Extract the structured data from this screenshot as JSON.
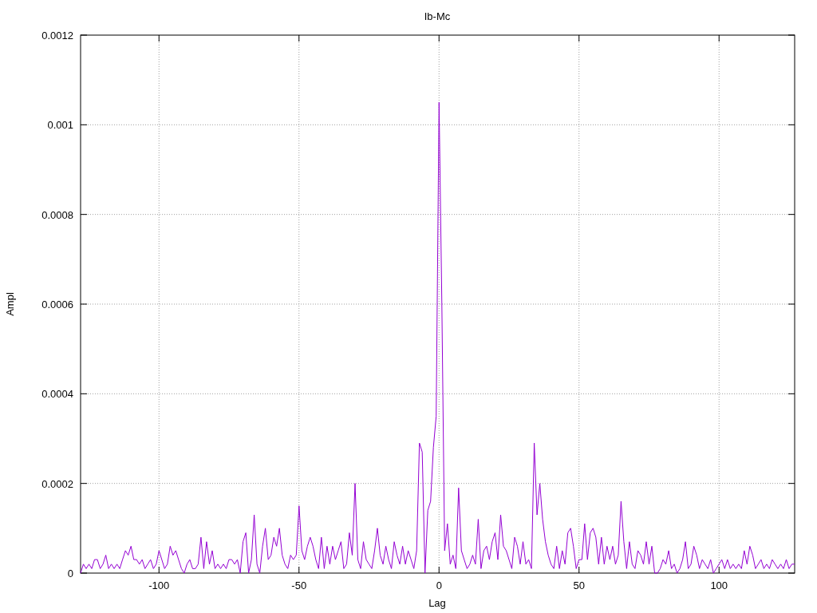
{
  "chart_data": {
    "type": "line",
    "grid": true,
    "title": "Ib-Mc",
    "xlabel": "Lag",
    "ylabel": "Ampl",
    "xlim": [
      -128,
      127
    ],
    "ylim": [
      0,
      0.0012
    ],
    "xticks": [
      -100,
      -50,
      0,
      50,
      100
    ],
    "yticks": [
      {
        "value": 0,
        "label": "0"
      },
      {
        "value": 0.0002,
        "label": "0.0002"
      },
      {
        "value": 0.0004,
        "label": "0.0004"
      },
      {
        "value": 0.0006,
        "label": "0.0006"
      },
      {
        "value": 0.0008,
        "label": "0.0008"
      },
      {
        "value": 0.001,
        "label": "0.001"
      },
      {
        "value": 0.0012,
        "label": "0.0012"
      }
    ],
    "x": [
      -128,
      -127,
      -126,
      -125,
      -124,
      -123,
      -122,
      -121,
      -120,
      -119,
      -118,
      -117,
      -116,
      -115,
      -114,
      -113,
      -112,
      -111,
      -110,
      -109,
      -108,
      -107,
      -106,
      -105,
      -104,
      -103,
      -102,
      -101,
      -100,
      -99,
      -98,
      -97,
      -96,
      -95,
      -94,
      -93,
      -92,
      -91,
      -90,
      -89,
      -88,
      -87,
      -86,
      -85,
      -84,
      -83,
      -82,
      -81,
      -80,
      -79,
      -78,
      -77,
      -76,
      -75,
      -74,
      -73,
      -72,
      -71,
      -70,
      -69,
      -68,
      -67,
      -66,
      -65,
      -64,
      -63,
      -62,
      -61,
      -60,
      -59,
      -58,
      -57,
      -56,
      -55,
      -54,
      -53,
      -52,
      -51,
      -50,
      -49,
      -48,
      -47,
      -46,
      -45,
      -44,
      -43,
      -42,
      -41,
      -40,
      -39,
      -38,
      -37,
      -36,
      -35,
      -34,
      -33,
      -32,
      -31,
      -30,
      -29,
      -28,
      -27,
      -26,
      -25,
      -24,
      -23,
      -22,
      -21,
      -20,
      -19,
      -18,
      -17,
      -16,
      -15,
      -14,
      -13,
      -12,
      -11,
      -10,
      -9,
      -8,
      -7,
      -6,
      -5,
      -4,
      -3,
      -2,
      -1,
      0,
      1,
      2,
      3,
      4,
      5,
      6,
      7,
      8,
      9,
      10,
      11,
      12,
      13,
      14,
      15,
      16,
      17,
      18,
      19,
      20,
      21,
      22,
      23,
      24,
      25,
      26,
      27,
      28,
      29,
      30,
      31,
      32,
      33,
      34,
      35,
      36,
      37,
      38,
      39,
      40,
      41,
      42,
      43,
      44,
      45,
      46,
      47,
      48,
      49,
      50,
      51,
      52,
      53,
      54,
      55,
      56,
      57,
      58,
      59,
      60,
      61,
      62,
      63,
      64,
      65,
      66,
      67,
      68,
      69,
      70,
      71,
      72,
      73,
      74,
      75,
      76,
      77,
      78,
      79,
      80,
      81,
      82,
      83,
      84,
      85,
      86,
      87,
      88,
      89,
      90,
      91,
      92,
      93,
      94,
      95,
      96,
      97,
      98,
      99,
      100,
      101,
      102,
      103,
      104,
      105,
      106,
      107,
      108,
      109,
      110,
      111,
      112,
      113,
      114,
      115,
      116,
      117,
      118,
      119,
      120,
      121,
      122,
      123,
      124,
      125,
      126,
      127
    ],
    "series": [
      {
        "color": "#9400d3",
        "values": [
          0,
          2e-05,
          1e-05,
          2e-05,
          1e-05,
          3e-05,
          3e-05,
          1e-05,
          2e-05,
          4e-05,
          1e-05,
          2e-05,
          1e-05,
          2e-05,
          1e-05,
          3e-05,
          5e-05,
          4e-05,
          6e-05,
          3e-05,
          3e-05,
          2e-05,
          3e-05,
          1e-05,
          2e-05,
          3e-05,
          1e-05,
          2e-05,
          5e-05,
          3e-05,
          1e-05,
          2e-05,
          6e-05,
          4e-05,
          5e-05,
          3e-05,
          1e-05,
          0,
          2e-05,
          3e-05,
          1e-05,
          1e-05,
          2e-05,
          8e-05,
          1e-05,
          7e-05,
          2e-05,
          5e-05,
          1e-05,
          2e-05,
          1e-05,
          2e-05,
          1e-05,
          3e-05,
          3e-05,
          2e-05,
          3e-05,
          0,
          7e-05,
          9e-05,
          0,
          3e-05,
          0.00013,
          2e-05,
          0,
          6e-05,
          0.0001,
          3e-05,
          4e-05,
          8e-05,
          6e-05,
          0.0001,
          4e-05,
          2e-05,
          1e-05,
          4e-05,
          3e-05,
          4e-05,
          0.00015,
          5e-05,
          3e-05,
          6e-05,
          8e-05,
          6e-05,
          3e-05,
          1e-05,
          8e-05,
          1e-05,
          6e-05,
          2e-05,
          6e-05,
          3e-05,
          5e-05,
          7e-05,
          1e-05,
          2e-05,
          9e-05,
          4e-05,
          0.0002,
          3e-05,
          1e-05,
          7e-05,
          3e-05,
          2e-05,
          1e-05,
          5e-05,
          0.0001,
          4e-05,
          2e-05,
          6e-05,
          3e-05,
          1e-05,
          7e-05,
          4e-05,
          2e-05,
          6e-05,
          2e-05,
          5e-05,
          3e-05,
          1e-05,
          5e-05,
          0.00029,
          0.00027,
          0,
          0.00014,
          0.00016,
          0.00028,
          0.00035,
          0.00105,
          0.0006,
          5e-05,
          0.00011,
          2e-05,
          4e-05,
          1e-05,
          0.00019,
          5e-05,
          3e-05,
          1e-05,
          2e-05,
          4e-05,
          2e-05,
          0.00012,
          1e-05,
          5e-05,
          6e-05,
          3e-05,
          7e-05,
          9e-05,
          3e-05,
          0.00013,
          6e-05,
          5e-05,
          3e-05,
          1e-05,
          8e-05,
          6e-05,
          2e-05,
          7e-05,
          2e-05,
          3e-05,
          1e-05,
          0.00029,
          0.00013,
          0.0002,
          0.00012,
          7e-05,
          4e-05,
          2e-05,
          1e-05,
          6e-05,
          1e-05,
          5e-05,
          2e-05,
          9e-05,
          0.0001,
          6e-05,
          1e-05,
          3e-05,
          3e-05,
          0.00011,
          3e-05,
          9e-05,
          0.0001,
          8e-05,
          2e-05,
          8e-05,
          2e-05,
          6e-05,
          3e-05,
          6e-05,
          2e-05,
          4e-05,
          0.00016,
          7e-05,
          1e-05,
          7e-05,
          2e-05,
          1e-05,
          5e-05,
          4e-05,
          2e-05,
          7e-05,
          2e-05,
          6e-05,
          0,
          0,
          1e-05,
          3e-05,
          2e-05,
          5e-05,
          1e-05,
          2e-05,
          0,
          1e-05,
          3e-05,
          7e-05,
          1e-05,
          2e-05,
          6e-05,
          4e-05,
          1e-05,
          3e-05,
          2e-05,
          1e-05,
          3e-05,
          0,
          1e-05,
          2e-05,
          3e-05,
          1e-05,
          3e-05,
          1e-05,
          2e-05,
          1e-05,
          2e-05,
          1e-05,
          5e-05,
          2e-05,
          6e-05,
          4e-05,
          1e-05,
          2e-05,
          3e-05,
          1e-05,
          2e-05,
          1e-05,
          3e-05,
          2e-05,
          1e-05,
          2e-05,
          1e-05,
          3e-05,
          1e-05,
          2e-05,
          2e-05
        ]
      }
    ]
  }
}
